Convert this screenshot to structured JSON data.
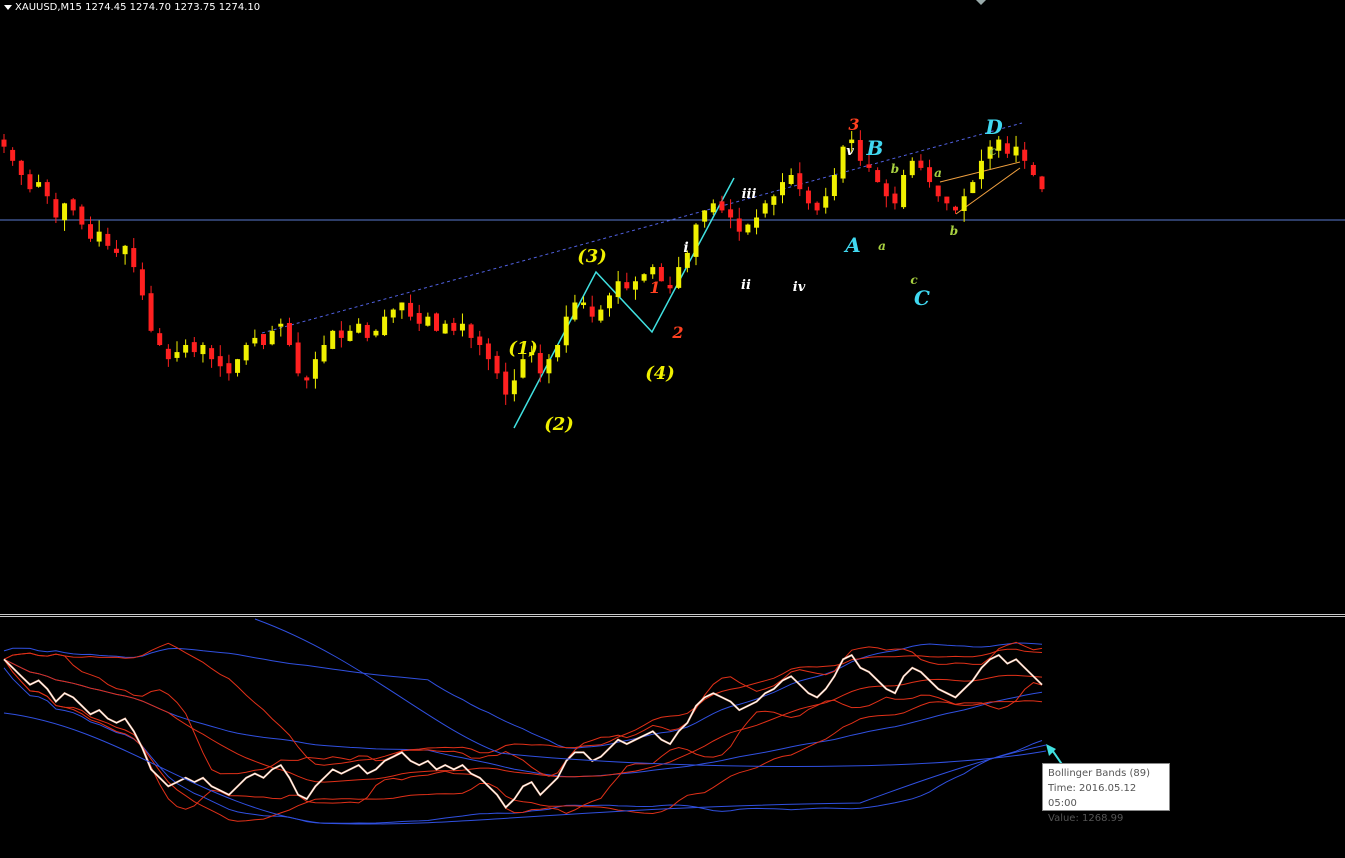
{
  "header": {
    "symbol": "XAUUSD,M15",
    "open": "1274.45",
    "high": "1274.70",
    "low": "1273.75",
    "close": "1274.10"
  },
  "tooltip": {
    "line1": "Bollinger Bands (89)",
    "line2": "Time: 2016.05.12 05:00",
    "line3": "Value: 1268.99"
  },
  "colors": {
    "background": "#000000",
    "bull_candle": "#f0f000",
    "bear_candle": "#ff2020",
    "hline": "#5a7ad0",
    "trend_dashed": "#5060e0",
    "wave_line": "#40e0e0",
    "bb_blue": "#3050e0",
    "bb_red": "#e03018",
    "price_line": "#ffffff",
    "price_line_alt": "#f0b090"
  },
  "chart_data": [
    {
      "type": "candlestick",
      "symbol": "XAUUSD",
      "timeframe": "M15",
      "price_close_series": [
        1290,
        1288,
        1286,
        1284,
        1285,
        1283,
        1280,
        1282,
        1281,
        1279,
        1277,
        1278,
        1276,
        1275,
        1276,
        1273,
        1269,
        1264,
        1262,
        1260,
        1261,
        1262,
        1261,
        1262,
        1260,
        1259,
        1258,
        1260,
        1262,
        1263,
        1262,
        1264,
        1265,
        1262,
        1258,
        1257,
        1260,
        1262,
        1264,
        1263,
        1264,
        1265,
        1263,
        1264,
        1266,
        1267,
        1268,
        1266,
        1265,
        1266,
        1264,
        1265,
        1264,
        1265,
        1263,
        1262,
        1260,
        1258,
        1255,
        1257,
        1260,
        1261,
        1258,
        1260,
        1262,
        1266,
        1268,
        1268,
        1266,
        1267,
        1269,
        1271,
        1270,
        1271,
        1272,
        1273,
        1271,
        1270,
        1273,
        1275,
        1279,
        1281,
        1282,
        1281,
        1280,
        1278,
        1279,
        1280,
        1282,
        1283,
        1285,
        1286,
        1284,
        1282,
        1281,
        1283,
        1286,
        1290,
        1291,
        1288,
        1287,
        1285,
        1283,
        1282,
        1286,
        1288,
        1287,
        1285,
        1283,
        1282,
        1281,
        1283,
        1285,
        1288,
        1290,
        1291,
        1289,
        1290,
        1288,
        1286,
        1284
      ],
      "hline_price": 1274.1,
      "wave_labels": [
        {
          "text": "(1)",
          "color": "#f0f000"
        },
        {
          "text": "(2)",
          "color": "#f0f000"
        },
        {
          "text": "(3)",
          "color": "#f0f000"
        },
        {
          "text": "(4)",
          "color": "#f0f000"
        },
        {
          "text": "1",
          "color": "#ff4020"
        },
        {
          "text": "2",
          "color": "#ff4020"
        },
        {
          "text": "3",
          "color": "#ff4020"
        },
        {
          "text": "i",
          "color": "#ffffff"
        },
        {
          "text": "ii",
          "color": "#ffffff"
        },
        {
          "text": "iii",
          "color": "#ffffff"
        },
        {
          "text": "iv",
          "color": "#ffffff"
        },
        {
          "text": "v",
          "color": "#ffffff"
        },
        {
          "text": "A",
          "color": "#40d8f0"
        },
        {
          "text": "B",
          "color": "#40d8f0"
        },
        {
          "text": "C",
          "color": "#40d8f0"
        },
        {
          "text": "D",
          "color": "#40d8f0"
        },
        {
          "text": "a",
          "color": "#a8d040"
        },
        {
          "text": "b",
          "color": "#a8d040"
        },
        {
          "text": "c",
          "color": "#a8d040"
        },
        {
          "text": "a",
          "color": "#a8d040"
        },
        {
          "text": "b",
          "color": "#a8d040"
        },
        {
          "text": "c",
          "color": "#a8d040"
        }
      ]
    },
    {
      "type": "line",
      "indicator": "Bollinger Bands (89)",
      "series": [
        {
          "name": "Bollinger Bands (89)",
          "color": "#3050e0"
        }
      ]
    }
  ]
}
